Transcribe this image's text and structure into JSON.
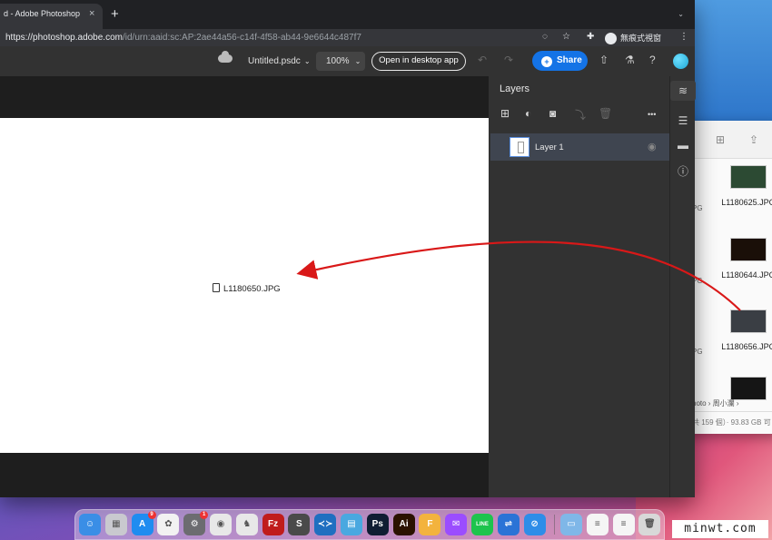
{
  "browser": {
    "tab_title": "d - Adobe Photoshop",
    "tab_close": "×",
    "new_tab": "+",
    "tab_menu": "⌄",
    "url_host": "https://photoshop.adobe.com",
    "url_path": "/id/urn:aaid:sc:AP:2ae44a56-c14f-4f58-ab44-9e6644c487f7",
    "incognito_label": "無痕式視窗",
    "menu_glyph": "⋮"
  },
  "ps_toolbar": {
    "document_name": "Untitled.psdc",
    "zoom_value": "100%",
    "open_desktop_label": "Open in desktop app",
    "share_label": "Share"
  },
  "canvas": {
    "dropped_file_label": "L1180650.JPG"
  },
  "layers_panel": {
    "title": "Layers",
    "more_glyph": "•••",
    "layers": [
      {
        "name": "Layer 1",
        "selected": true
      }
    ]
  },
  "finder": {
    "files": [
      {
        "name": "L1180625.JPG",
        "thumb": "#2c4a33"
      },
      {
        "name": "L1180644.JPG",
        "thumb": "#1a0f08"
      },
      {
        "name": "L1180656.JPG",
        "thumb": "#3a3e44"
      },
      {
        "name": "",
        "thumb": "#151515"
      }
    ],
    "cut_labels": [
      "PG",
      "PG",
      "PG"
    ],
    "path_text": "hoto › 周小瀾 ›",
    "status_text": "共 159 個）· 93.83 GB 可",
    "grid_glyph": "⊞",
    "share_glyph": "⇪"
  },
  "dock": {
    "apps": [
      {
        "name": "finder",
        "color": "#3a8ee6",
        "glyph": "☺"
      },
      {
        "name": "launchpad",
        "color": "#c9c9cf",
        "glyph": "▦"
      },
      {
        "name": "app-store",
        "color": "#1f8cf0",
        "glyph": "A",
        "badge": "9"
      },
      {
        "name": "photos",
        "color": "#f2f2f2",
        "glyph": "✿"
      },
      {
        "name": "system-preferences",
        "color": "#6c6c70",
        "glyph": "⚙",
        "badge": "1"
      },
      {
        "name": "chrome",
        "color": "#e8e8e8",
        "glyph": "◉"
      },
      {
        "name": "evernote",
        "color": "#e8e8e8",
        "glyph": "♞"
      },
      {
        "name": "filezilla",
        "color": "#c01c1c",
        "glyph": "Fz"
      },
      {
        "name": "sublime-text",
        "color": "#4a4a4a",
        "glyph": "S"
      },
      {
        "name": "vscode",
        "color": "#1f6fc0",
        "glyph": "≺≻"
      },
      {
        "name": "notes-alt",
        "color": "#49a8e0",
        "glyph": "▤"
      },
      {
        "name": "photoshop",
        "color": "#0f1d33",
        "glyph": "Ps"
      },
      {
        "name": "illustrator",
        "color": "#2b1200",
        "glyph": "Ai"
      },
      {
        "name": "font-app",
        "color": "#f3b33d",
        "glyph": "F"
      },
      {
        "name": "messenger",
        "color": "#9b4dff",
        "glyph": "✉"
      },
      {
        "name": "line",
        "color": "#1dc44d",
        "glyph": "LINE"
      },
      {
        "name": "transfer",
        "color": "#2b73d6",
        "glyph": "⇌"
      },
      {
        "name": "safari",
        "color": "#2e8de8",
        "glyph": "⊘"
      }
    ],
    "docs": [
      {
        "name": "downloads-folder",
        "color": "#7fb7e8",
        "glyph": "▭"
      },
      {
        "name": "document",
        "color": "#f5f5f5",
        "glyph": "≡"
      },
      {
        "name": "document-2",
        "color": "#f5f5f5",
        "glyph": "≡"
      },
      {
        "name": "trash",
        "color": "#d8d8d8",
        "glyph": "🗑"
      }
    ]
  },
  "watermark": "minwt.com"
}
